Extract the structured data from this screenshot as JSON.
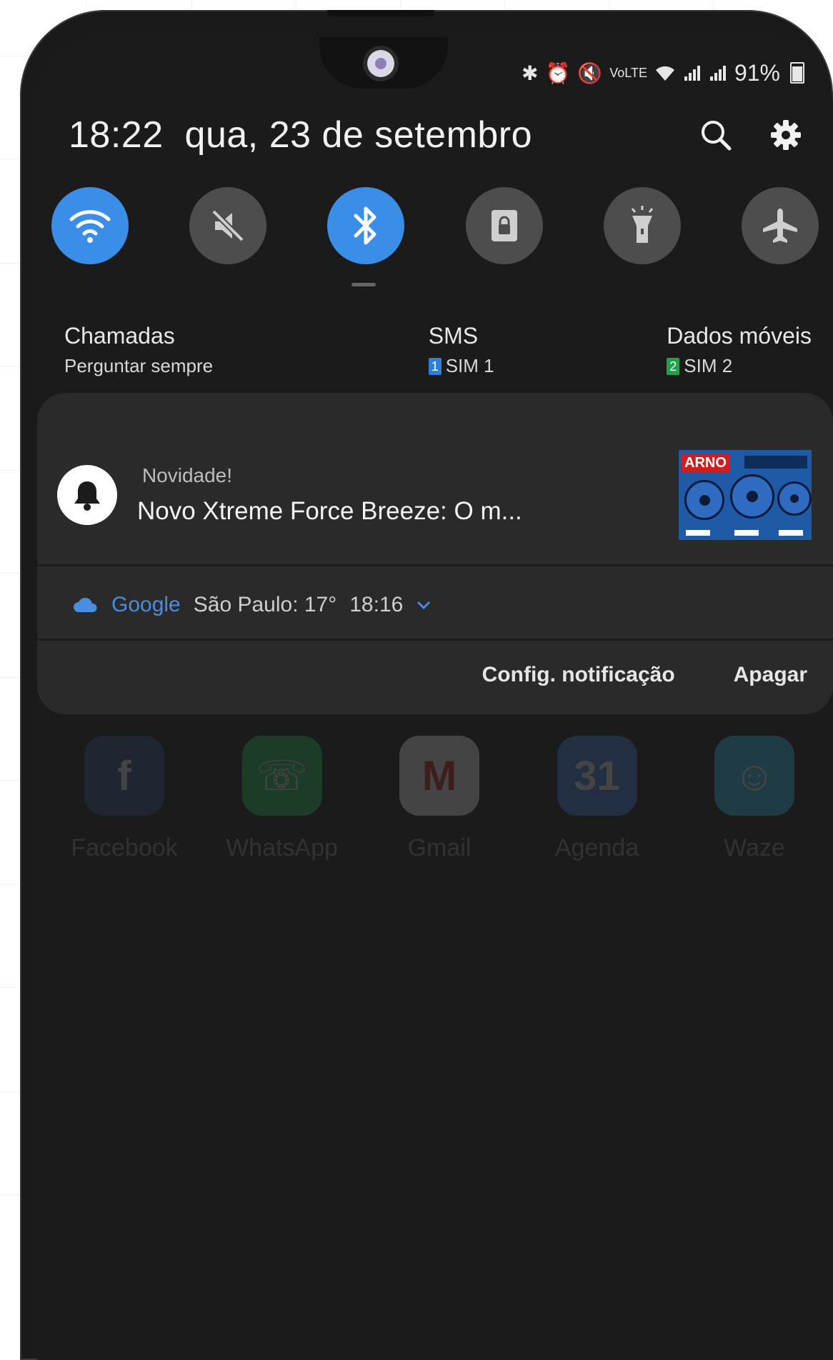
{
  "status_bar": {
    "battery_percent": "91%"
  },
  "header": {
    "time": "18:22",
    "date": "qua, 23 de setembro"
  },
  "quick_toggles": [
    {
      "name": "wifi",
      "on": true
    },
    {
      "name": "mute",
      "on": false
    },
    {
      "name": "bluetooth",
      "on": true
    },
    {
      "name": "screen-lock",
      "on": false
    },
    {
      "name": "flashlight",
      "on": false
    },
    {
      "name": "airplane-mode",
      "on": false
    }
  ],
  "sim": {
    "calls": {
      "title": "Chamadas",
      "value": "Perguntar sempre"
    },
    "sms": {
      "title": "SMS",
      "badge": "1",
      "value": "SIM 1"
    },
    "data": {
      "title": "Dados móveis",
      "badge": "2",
      "value": "SIM 2"
    }
  },
  "notification": {
    "app_name": "Novidade!",
    "message": "Novo Xtreme Force Breeze: O m...",
    "thumbnail_brand": "ARNO"
  },
  "weather": {
    "provider": "Google",
    "location_temp": "São Paulo: 17°",
    "time": "18:16"
  },
  "card_actions": {
    "settings": "Config. notificação",
    "clear": "Apagar"
  },
  "dock_apps": [
    {
      "label": "Facebook",
      "color": "#3b5998",
      "glyph": "f"
    },
    {
      "label": "WhatsApp",
      "color": "#25d366",
      "glyph": "☏"
    },
    {
      "label": "Gmail",
      "color": "#ffffff",
      "glyph": "M"
    },
    {
      "label": "Agenda",
      "color": "#4285f4",
      "glyph": "31"
    },
    {
      "label": "Waze",
      "color": "#33ccff",
      "glyph": "☺"
    }
  ]
}
